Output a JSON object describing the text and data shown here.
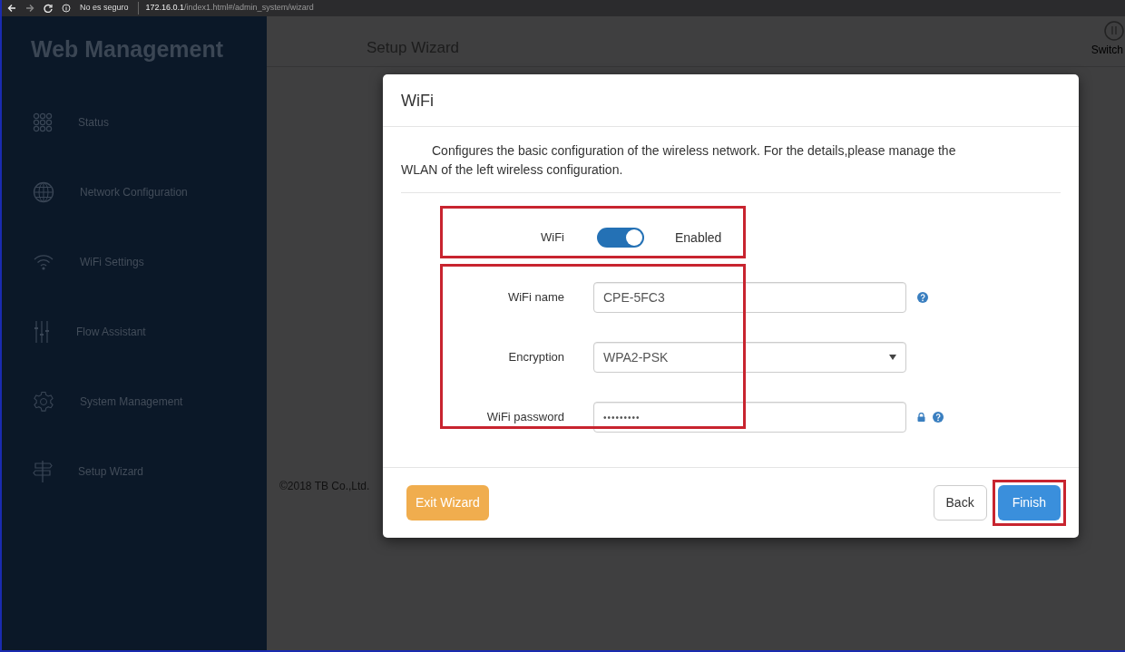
{
  "browser": {
    "security_label": "No es seguro",
    "url_host": "172.16.0.1",
    "url_path": "/index1.html#/admin_system/wizard"
  },
  "sidebar": {
    "title": "Web Management",
    "items": [
      {
        "label": "Status",
        "kind": "grid"
      },
      {
        "label": "Network Configuration",
        "kind": "globe"
      },
      {
        "label": "WiFi Settings",
        "kind": "wifi"
      },
      {
        "label": "Flow Assistant",
        "kind": "sliders"
      },
      {
        "label": "System Management",
        "kind": "gear"
      },
      {
        "label": "Setup Wizard",
        "kind": "signpost"
      }
    ]
  },
  "page": {
    "title": "Setup Wizard",
    "switch_label": "Switch",
    "footer": "©2018 TB Co.,Ltd."
  },
  "modal": {
    "title": "WiFi",
    "description": "Configures the basic configuration of the wireless network. For the details,please manage the WLAN of the left wireless configuration.",
    "toggle": {
      "label": "WiFi",
      "on": true,
      "status": "Enabled",
      "highlighted": true
    },
    "fields_highlighted": true,
    "fields": [
      {
        "label": "WiFi name",
        "kind": "text",
        "value": "CPE-5FC3",
        "lock": false,
        "help": true
      },
      {
        "label": "Encryption",
        "kind": "select",
        "value": "WPA2-PSK",
        "lock": false,
        "help": false
      },
      {
        "label": "WiFi password",
        "kind": "password",
        "value": "•••••••••",
        "lock": true,
        "help": true
      }
    ],
    "buttons": [
      {
        "label": "Exit Wizard",
        "kind": "warning",
        "highlighted": false
      },
      {
        "label": "Back",
        "kind": "default",
        "highlighted": false
      },
      {
        "label": "Finish",
        "kind": "primary",
        "highlighted": true
      }
    ]
  }
}
